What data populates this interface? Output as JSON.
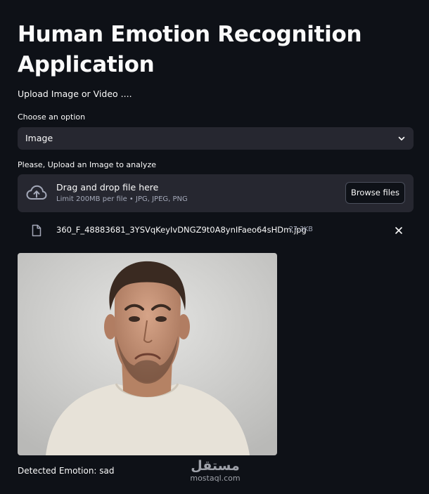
{
  "header": {
    "title": "Human Emotion Recognition Application",
    "subtitle": "Upload Image or Video ...."
  },
  "option_select": {
    "label": "Choose an option",
    "value": "Image",
    "icon": "chevron-down-icon"
  },
  "uploader": {
    "label": "Please, Upload an Image to analyze",
    "drop_title": "Drag and drop file here",
    "limit_text": "Limit 200MB per file • JPG, JPEG, PNG",
    "browse_label": "Browse files",
    "icon": "cloud-upload-icon"
  },
  "uploaded_file": {
    "name": "360_F_48883681_3YSVqKeyIvDNGZ9t0A8ynIFaeo64sHDm.jpg",
    "size": "27.3KB",
    "icon": "file-icon",
    "remove_icon": "close-icon"
  },
  "result": {
    "text": "Detected Emotion: sad"
  },
  "watermark": {
    "arabic": "مستقل",
    "latin": "mostaql.com"
  },
  "colors": {
    "background": "#0e1117",
    "widget": "#262730",
    "text": "#fafafa",
    "muted": "#a3a8b8"
  }
}
